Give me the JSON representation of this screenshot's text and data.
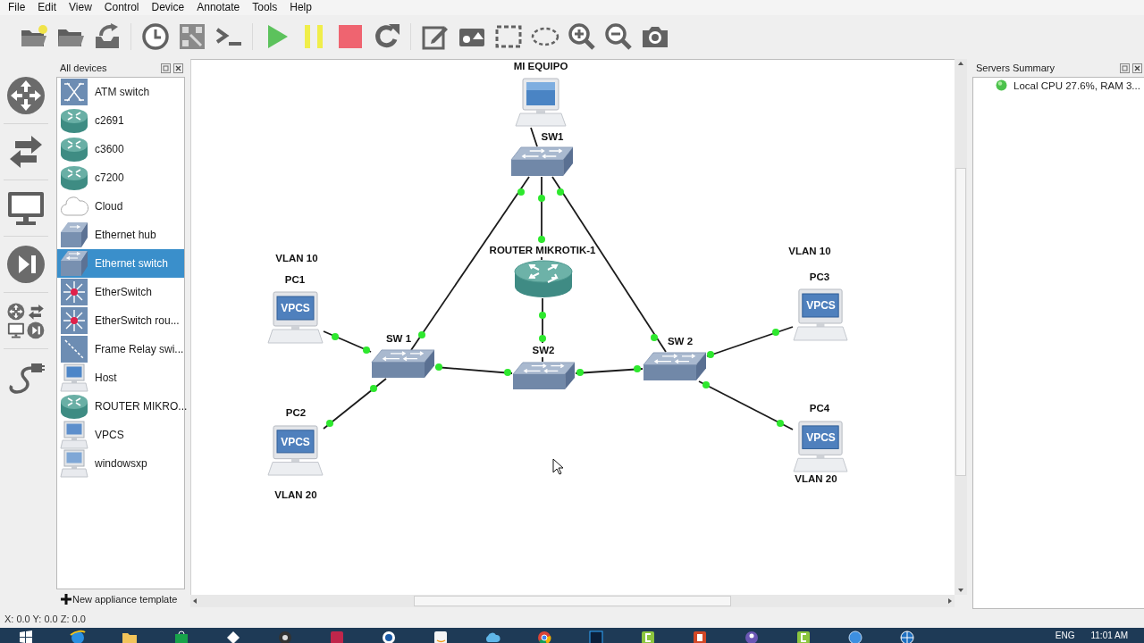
{
  "menu": [
    "File",
    "Edit",
    "View",
    "Control",
    "Device",
    "Annotate",
    "Tools",
    "Help"
  ],
  "toolbar": [
    {
      "buttons": [
        {
          "kind": "new-project"
        },
        {
          "kind": "open-project"
        },
        {
          "kind": "import"
        }
      ]
    },
    {
      "buttons": [
        {
          "kind": "snapshot"
        },
        {
          "kind": "interfaces"
        },
        {
          "kind": "console"
        }
      ]
    },
    {
      "buttons": [
        {
          "kind": "start"
        },
        {
          "kind": "suspend"
        },
        {
          "kind": "stop"
        },
        {
          "kind": "reload"
        }
      ]
    },
    {
      "buttons": [
        {
          "kind": "note"
        },
        {
          "kind": "image"
        },
        {
          "kind": "rectangle"
        },
        {
          "kind": "ellipse"
        },
        {
          "kind": "zoom-in"
        },
        {
          "kind": "zoom-out"
        },
        {
          "kind": "screenshot"
        }
      ]
    }
  ],
  "device_types": [
    {
      "kind": "routers"
    },
    {
      "kind": "switches"
    },
    {
      "kind": "end-devices"
    },
    {
      "kind": "security"
    },
    {
      "kind": "all"
    },
    {
      "kind": "add-link"
    }
  ],
  "devices_panel": {
    "title": "All devices",
    "items": [
      {
        "label": "ATM switch",
        "kind": "atm",
        "selected": false
      },
      {
        "label": "c2691",
        "kind": "router",
        "selected": false
      },
      {
        "label": "c3600",
        "kind": "router",
        "selected": false
      },
      {
        "label": "c7200",
        "kind": "router",
        "selected": false
      },
      {
        "label": "Cloud",
        "kind": "cloud",
        "selected": false
      },
      {
        "label": "Ethernet hub",
        "kind": "hub",
        "selected": false
      },
      {
        "label": "Ethernet switch",
        "kind": "switch",
        "selected": true
      },
      {
        "label": "EtherSwitch",
        "kind": "etherswitch",
        "selected": false
      },
      {
        "label": "EtherSwitch rou...",
        "kind": "etherswitch",
        "selected": false
      },
      {
        "label": "Frame Relay swi...",
        "kind": "frame-relay",
        "selected": false
      },
      {
        "label": "Host",
        "kind": "host",
        "selected": false
      },
      {
        "label": "ROUTER MIKRO...",
        "kind": "router",
        "selected": false
      },
      {
        "label": "VPCS",
        "kind": "vpcs",
        "selected": false
      },
      {
        "label": "windowsxp",
        "kind": "windowsxp",
        "selected": false
      }
    ],
    "new_template": "New appliance template"
  },
  "canvas": {
    "nodes": [
      {
        "label": "MI EQUIPO",
        "kind": "host"
      },
      {
        "label": "SW1",
        "kind": "switch"
      },
      {
        "label": "ROUTER MIKROTIK-1",
        "kind": "router"
      },
      {
        "label": "SW2",
        "kind": "switch"
      },
      {
        "label": "SW 1",
        "kind": "switch"
      },
      {
        "label": "SW 2",
        "kind": "switch"
      },
      {
        "label": "PC1",
        "kind": "vpcs",
        "screen": "VPCS"
      },
      {
        "label": "PC2",
        "kind": "vpcs",
        "screen": "VPCS"
      },
      {
        "label": "PC3",
        "kind": "vpcs",
        "screen": "VPCS"
      },
      {
        "label": "PC4",
        "kind": "vpcs",
        "screen": "VPCS"
      }
    ],
    "links": [
      {
        "up": true
      },
      {
        "up": true
      },
      {
        "up": true
      },
      {
        "up": true
      },
      {
        "up": true
      },
      {
        "up": true
      },
      {
        "up": true
      },
      {
        "up": true
      },
      {
        "up": true
      },
      {
        "up": true
      },
      {
        "up": true
      }
    ],
    "notes": [
      "VLAN 10",
      "VLAN 20",
      "VLAN 10",
      "VLAN 20"
    ]
  },
  "servers_panel": {
    "title": "Servers Summary",
    "servers": [
      {
        "text": "Local CPU 27.6%, RAM 3...",
        "running": true
      }
    ]
  },
  "status_bar": "X: 0.0 Y: 0.0 Z: 0.0",
  "taskbar": {
    "apps": [
      {
        "kind": "start"
      },
      {
        "kind": "browser"
      },
      {
        "kind": "folder"
      },
      {
        "kind": "store"
      },
      {
        "kind": "diamond"
      },
      {
        "kind": "disc"
      },
      {
        "kind": "media"
      },
      {
        "kind": "printer"
      },
      {
        "kind": "shop"
      },
      {
        "kind": "cloud"
      },
      {
        "kind": "chrome"
      },
      {
        "kind": "photo"
      },
      {
        "kind": "letter-c"
      },
      {
        "kind": "slides"
      },
      {
        "kind": "chat"
      },
      {
        "kind": "letter-c"
      },
      {
        "kind": "circle"
      },
      {
        "kind": "globe"
      }
    ],
    "language": "ENG",
    "clock": "11:01 AM"
  }
}
